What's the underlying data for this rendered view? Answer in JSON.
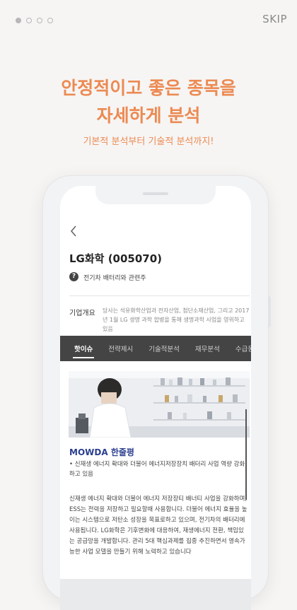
{
  "onboarding": {
    "skip_label": "SKIP",
    "headline_line1": "안정적이고 좋은 종목을",
    "headline_line2": "자세하게 분석",
    "subline": "기본적 분석부터 기술적 분석까지!",
    "page_indicator": {
      "total": 4,
      "current": 1
    }
  },
  "phone": {
    "back_icon": "chevron-left-icon",
    "company_title": "LG화학 (005070)",
    "help_icon_text": "?",
    "subtitle": "전기차 배터리와 관련주",
    "overview": {
      "label": "기업개요",
      "text": "당사는 석유화학산업과 전자산업, 첨단소재산업, 그리고 2017년 1월 LG 생명 과학 합병을 통해 생명과학 사업을 영위하고 있음"
    },
    "tabs": [
      {
        "label": "핫이슈",
        "active": true
      },
      {
        "label": "전략제시",
        "active": false
      },
      {
        "label": "기술적분석",
        "active": false
      },
      {
        "label": "재무분석",
        "active": false
      },
      {
        "label": "수급동",
        "active": false
      }
    ],
    "mowda": {
      "brand": "MOWDA",
      "suffix": " 한줄평"
    },
    "issue_text": "• 신재생 에너지 확대와 더불어 에너지저장장치 배터리 사업 역량 강화하고 있음",
    "body_text": "신재생 에너지 확대와 더불어 에너지 저장장티 배너티 사업을 강화하며, ESS는 전력을 저장하고 필요할때 사용합니다. 더불어 에너지 효율을 높이는 시스템으로 저탄소 성장을 목표로하고 있으며, 전기차의 배터리에 사용됩니다. LG화학은 기후변화에 대응하여, 재생에너지 전환, 책임있는 공급망을 개발합니다. 관리 5대 핵심과제를 집중 추진하면서 영속가능한 사업 모델을 만들기 위해 노력하고 있습니다"
  },
  "colors": {
    "accent": "#ec8a52",
    "background": "#f6f5f4",
    "tab_bar": "#444444",
    "brand_blue": "#2b3f8f"
  }
}
